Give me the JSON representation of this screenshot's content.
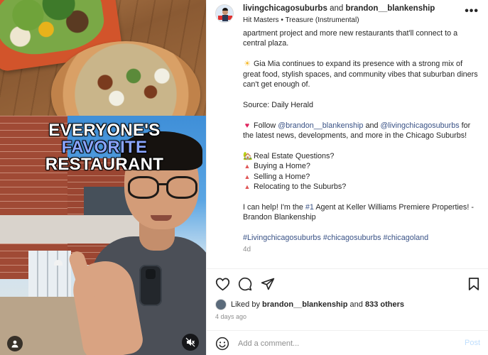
{
  "media": {
    "overlay_line1": "EVERYONE'S",
    "overlay_line2": "FAVORITE",
    "overlay_line3": "RESTAURANT"
  },
  "header": {
    "user1": "livingchicagosuburbs",
    "and_word": "and",
    "user2": "brandon__blankenship",
    "audio": "Hit Masters • Treasure (Instrumental)",
    "more_icon": "more-horizontal-icon"
  },
  "caption": {
    "p1": "apartment project and more new restaurants that'll connect to a central plaza.",
    "p2_emoji": "☀",
    "p2": "Gia Mia continues to expand its presence with a strong mix of great food, stylish spaces, and community vibes that suburban diners can't get enough of.",
    "source": "Source: Daily Herald",
    "follow_emoji": "♥",
    "follow_pre": "Follow",
    "follow_mention1": "@brandon__blankenship",
    "follow_and": "and",
    "follow_mention2": "@livingchicagosuburbs",
    "follow_post": "for the latest news, developments, and more in the Chicago Suburbs!",
    "q_emoji": "🏡",
    "q_title": "Real Estate Questions?",
    "bullet": "▲",
    "q1": "Buying a Home?",
    "q2": "Selling a Home?",
    "q3": "Relocating to the Suburbs?",
    "help_pre": "I can help! I'm the",
    "help_tag": "#1",
    "help_post": "Agent at Keller Williams Premiere Properties! - Brandon Blankenship",
    "hashtag1": "#Livingchicagosuburbs",
    "hashtag2": "#chicagosuburbs",
    "hashtag3": "#chicagoland",
    "age": "4d"
  },
  "engagement": {
    "liked_by": "Liked by",
    "liker": "brandon__blankenship",
    "and_word": "and",
    "others": "833 others",
    "date": "4 days ago"
  },
  "comment": {
    "placeholder": "Add a comment...",
    "post_label": "Post"
  },
  "colors": {
    "link": "#385185",
    "post_disabled": "#c0dffd",
    "muted": "#8e8e8e",
    "accent_overlay": "#8aa5ff"
  }
}
